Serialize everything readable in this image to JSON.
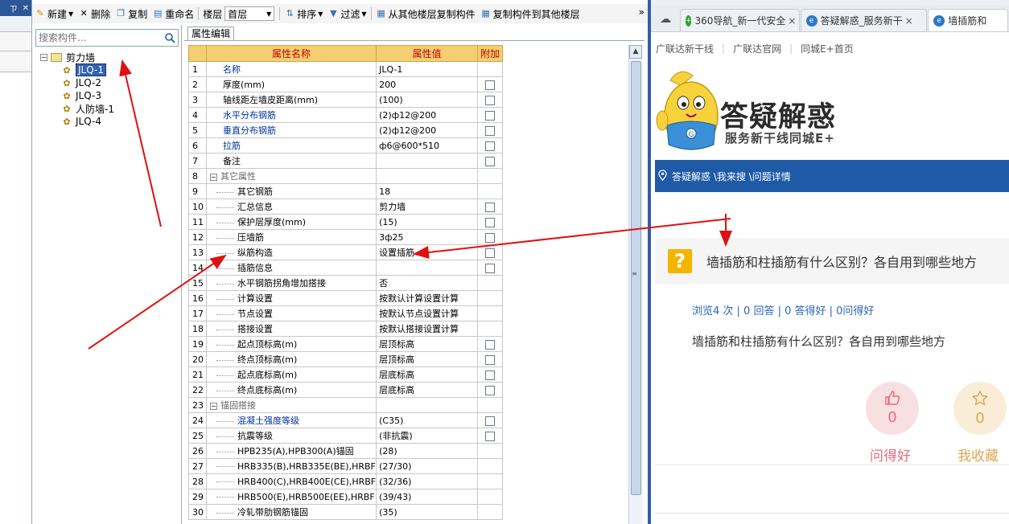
{
  "left_panel": {
    "pin_label": "ㄗ",
    "close_label": "✕"
  },
  "toolbar": {
    "new_label": "新建",
    "delete_label": "删除",
    "copy_label": "复制",
    "rename_label": "重命名",
    "floor_label": "楼层",
    "floor_value": "首层",
    "sort_label": "排序",
    "filter_label": "过滤",
    "copy_from_label": "从其他楼层复制构件",
    "copy_to_label": "复制构件到其他楼层",
    "more_label": "»"
  },
  "tree": {
    "search_placeholder": "搜索构件...",
    "root_label": "剪力墙",
    "items": [
      "JLQ-1",
      "JLQ-2",
      "JLQ-3",
      "人防墙-1",
      "JLQ-4"
    ],
    "selected_index": 0
  },
  "props": {
    "tab_label": "属性编辑",
    "headers": {
      "num": "",
      "name": "属性名称",
      "value": "属性值",
      "extra": "附加"
    },
    "rows": [
      {
        "num": "1",
        "name": "名称",
        "value": "JLQ-1",
        "style": "blue",
        "check": false,
        "indent": false
      },
      {
        "num": "2",
        "name": "厚度(mm)",
        "value": "200",
        "style": "normal",
        "check": true,
        "indent": false
      },
      {
        "num": "3",
        "name": "轴线距左墙皮距离(mm)",
        "value": "(100)",
        "style": "normal",
        "check": true,
        "indent": false
      },
      {
        "num": "4",
        "name": "水平分布钢筋",
        "value": "(2)ф12@200",
        "style": "blue",
        "check": true,
        "indent": false
      },
      {
        "num": "5",
        "name": "垂直分布钢筋",
        "value": "(2)ф12@200",
        "style": "blue",
        "check": true,
        "indent": false
      },
      {
        "num": "6",
        "name": "拉筋",
        "value": "ф6@600*510",
        "style": "blue",
        "check": true,
        "indent": false
      },
      {
        "num": "7",
        "name": "备注",
        "value": "",
        "style": "normal",
        "check": true,
        "indent": false
      },
      {
        "num": "8",
        "name": "其它属性",
        "value": "",
        "style": "group",
        "check": false,
        "indent": false
      },
      {
        "num": "9",
        "name": "其它钢筋",
        "value": "18",
        "style": "normal",
        "check": false,
        "indent": true
      },
      {
        "num": "10",
        "name": "汇总信息",
        "value": "剪力墙",
        "style": "normal",
        "check": true,
        "indent": true
      },
      {
        "num": "11",
        "name": "保护层厚度(mm)",
        "value": "(15)",
        "style": "normal",
        "check": true,
        "indent": true
      },
      {
        "num": "12",
        "name": "压墙筋",
        "value": "3ф25",
        "style": "normal",
        "check": true,
        "indent": true
      },
      {
        "num": "13",
        "name": "纵筋构造",
        "value": "设置插筋",
        "style": "normal",
        "check": true,
        "indent": true
      },
      {
        "num": "14",
        "name": "插筋信息",
        "value": "",
        "style": "normal",
        "check": true,
        "indent": true
      },
      {
        "num": "15",
        "name": "水平钢筋拐角增加搭接",
        "value": "否",
        "style": "normal",
        "check": false,
        "indent": true
      },
      {
        "num": "16",
        "name": "计算设置",
        "value": "按默认计算设置计算",
        "style": "normal",
        "check": false,
        "indent": true
      },
      {
        "num": "17",
        "name": "节点设置",
        "value": "按默认节点设置计算",
        "style": "normal",
        "check": false,
        "indent": true
      },
      {
        "num": "18",
        "name": "搭接设置",
        "value": "按默认搭接设置计算",
        "style": "normal",
        "check": false,
        "indent": true
      },
      {
        "num": "19",
        "name": "起点顶标高(m)",
        "value": "层顶标高",
        "style": "normal",
        "check": true,
        "indent": true
      },
      {
        "num": "20",
        "name": "终点顶标高(m)",
        "value": "层顶标高",
        "style": "normal",
        "check": true,
        "indent": true
      },
      {
        "num": "21",
        "name": "起点底标高(m)",
        "value": "层底标高",
        "style": "normal",
        "check": true,
        "indent": true
      },
      {
        "num": "22",
        "name": "终点底标高(m)",
        "value": "层底标高",
        "style": "normal",
        "check": true,
        "indent": true
      },
      {
        "num": "23",
        "name": "锚固搭接",
        "value": "",
        "style": "group",
        "check": false,
        "indent": false
      },
      {
        "num": "24",
        "name": "混凝土强度等级",
        "value": "(C35)",
        "style": "blue",
        "check": true,
        "indent": true
      },
      {
        "num": "25",
        "name": "抗震等级",
        "value": "(非抗震)",
        "style": "normal",
        "check": true,
        "indent": true
      },
      {
        "num": "26",
        "name": "HPB235(A),HPB300(A)锚固",
        "value": "(28)",
        "style": "normal",
        "check": false,
        "indent": true
      },
      {
        "num": "27",
        "name": "HRB335(B),HRB335E(BE),HRBF",
        "value": "(27/30)",
        "style": "normal",
        "check": false,
        "indent": true
      },
      {
        "num": "28",
        "name": "HRB400(C),HRB400E(CE),HRBF",
        "value": "(32/36)",
        "style": "normal",
        "check": false,
        "indent": true
      },
      {
        "num": "29",
        "name": "HRB500(E),HRB500E(EE),HRBF",
        "value": "(39/43)",
        "style": "normal",
        "check": false,
        "indent": true
      },
      {
        "num": "30",
        "name": "冷轧带肋钢筋锚固",
        "value": "(35)",
        "style": "normal",
        "check": false,
        "indent": true
      }
    ]
  },
  "browser": {
    "tabs": [
      {
        "label": "360导航_新一代安全",
        "icon": "360-icon"
      },
      {
        "label": "答疑解惑_服务新干",
        "icon": "ie-icon"
      },
      {
        "label": "墙插筋和",
        "icon": "ie-icon"
      }
    ],
    "links": [
      "广联达新干线",
      "广联达官网",
      "同城E+首页"
    ],
    "brand_title": "答疑解惑",
    "brand_sub": "服务新干线同城E+",
    "mascot_badge": "G",
    "breadcrumb": "答疑解惑 \\我来搜 \\问题详情",
    "question_icon": "?",
    "question_title": "墙插筋和柱插筋有什么区别？各自用到哪些地方",
    "stats": "浏览4 次 | 0 回答 | 0 答得好 | 0问得好",
    "body": "墙插筋和柱插筋有什么区别？各自用到哪些地方",
    "good_count": "0",
    "good_label": "问得好",
    "fav_count": "0",
    "fav_label": "我收藏",
    "colors": {
      "nav": "#1f5aa6",
      "question_icon": "#f5b400",
      "good": "#e86c7b",
      "fav": "#dca552"
    }
  }
}
